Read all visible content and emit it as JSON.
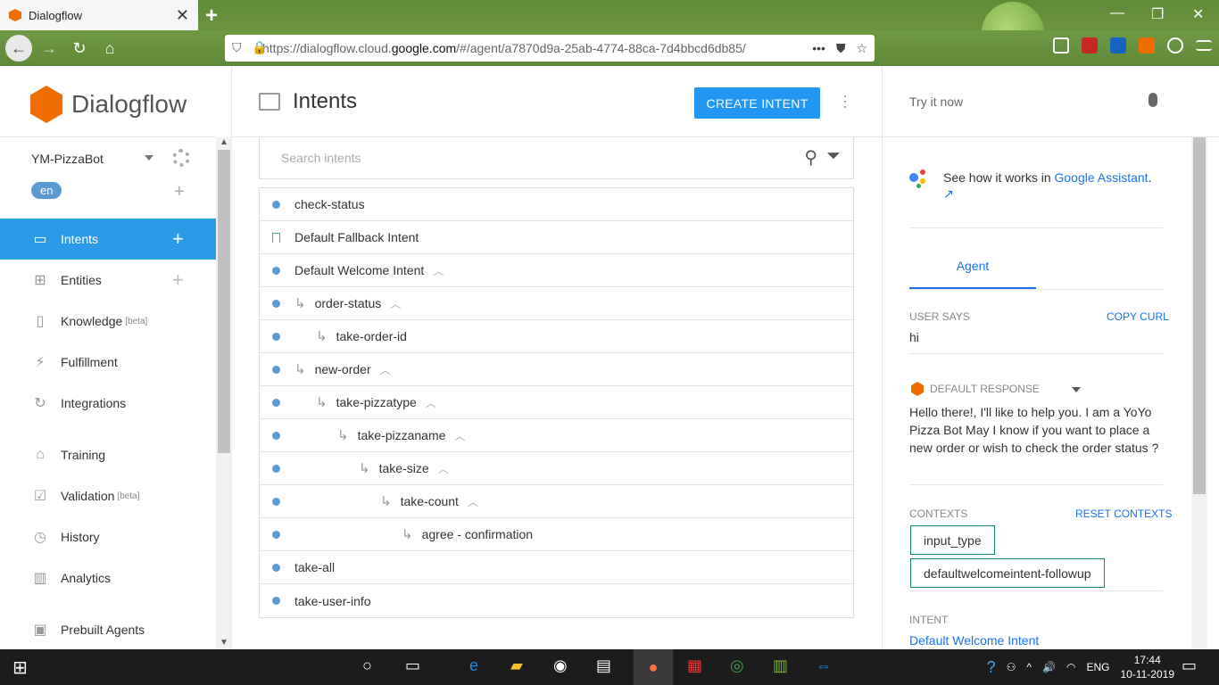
{
  "browser": {
    "tab_title": "Dialogflow",
    "tab_close": "✕",
    "new_tab": "+",
    "url_prefix": "https://dialogflow.cloud.",
    "url_domain": "google.com",
    "url_rest": "/#/agent/a7870d9a-25ab-4774-88ca-7d4bbcd6db85/",
    "url_actions": "•••",
    "window_controls": [
      "—",
      "❐",
      "✕"
    ]
  },
  "sidebar": {
    "brand": "Dialogflow",
    "agent_name": "YM-PizzaBot",
    "language": "en",
    "add_lang": "+",
    "items": [
      {
        "label": "Intents",
        "beta": "",
        "plus": "+",
        "icon": "chat-icon"
      },
      {
        "label": "Entities",
        "beta": "",
        "plus": "+",
        "icon": "sitemap-icon"
      },
      {
        "label": "Knowledge",
        "beta": "[beta]",
        "plus": "",
        "icon": "book-icon"
      },
      {
        "label": "Fulfillment",
        "beta": "",
        "plus": "",
        "icon": "bolt-icon"
      },
      {
        "label": "Integrations",
        "beta": "",
        "plus": "",
        "icon": "sync-icon"
      },
      {
        "label": "Training",
        "beta": "",
        "plus": "",
        "icon": "graduation-icon"
      },
      {
        "label": "Validation",
        "beta": "[beta]",
        "plus": "",
        "icon": "check-icon"
      },
      {
        "label": "History",
        "beta": "",
        "plus": "",
        "icon": "clock-icon"
      },
      {
        "label": "Analytics",
        "beta": "",
        "plus": "",
        "icon": "chart-icon"
      },
      {
        "label": "Prebuilt Agents",
        "beta": "",
        "plus": "",
        "icon": "agents-icon"
      }
    ]
  },
  "main": {
    "title": "Intents",
    "create_button": "CREATE INTENT",
    "search_placeholder": "Search intents",
    "intents": [
      {
        "name": "check-status",
        "depth": 0,
        "child": false,
        "chev": false,
        "marker": "dot"
      },
      {
        "name": "Default Fallback Intent",
        "depth": 0,
        "child": false,
        "chev": false,
        "marker": "bookmark"
      },
      {
        "name": "Default Welcome Intent",
        "depth": 0,
        "child": false,
        "chev": true,
        "marker": "dot"
      },
      {
        "name": "order-status",
        "depth": 0,
        "child": true,
        "chev": true,
        "marker": "dot"
      },
      {
        "name": "take-order-id",
        "depth": 1,
        "child": true,
        "chev": false,
        "marker": "dot"
      },
      {
        "name": "new-order",
        "depth": 0,
        "child": true,
        "chev": true,
        "marker": "dot"
      },
      {
        "name": "take-pizzatype",
        "depth": 1,
        "child": true,
        "chev": true,
        "marker": "dot"
      },
      {
        "name": "take-pizzaname",
        "depth": 2,
        "child": true,
        "chev": true,
        "marker": "dot"
      },
      {
        "name": "take-size",
        "depth": 3,
        "child": true,
        "chev": true,
        "marker": "dot"
      },
      {
        "name": "take-count",
        "depth": 4,
        "child": true,
        "chev": true,
        "marker": "dot"
      },
      {
        "name": "agree - confirmation",
        "depth": 5,
        "child": true,
        "chev": false,
        "marker": "dot"
      },
      {
        "name": "take-all",
        "depth": 0,
        "child": false,
        "chev": false,
        "marker": "dot"
      },
      {
        "name": "take-user-info",
        "depth": 0,
        "child": false,
        "chev": false,
        "marker": "dot"
      }
    ]
  },
  "right": {
    "try_placeholder": "Try it now",
    "see_text": "See how it works in ",
    "see_link": "Google Assistant",
    "see_period": ".",
    "agent_tab": "Agent",
    "user_says_label": "USER SAYS",
    "copy_curl": "COPY CURL",
    "user_says_value": "hi",
    "default_response_label": "DEFAULT RESPONSE",
    "default_response": "Hello there!, I'll like to help you. I am a YoYo Pizza Bot May I know if you want to place a new order or wish to check the order status ?",
    "contexts_label": "CONTEXTS",
    "reset_contexts": "RESET CONTEXTS",
    "contexts": [
      "input_type",
      "defaultwelcomeintent-followup"
    ],
    "intent_label": "INTENT",
    "intent_value": "Default Welcome Intent"
  },
  "taskbar": {
    "lang": "ENG",
    "time": "17:44",
    "date": "10-11-2019"
  },
  "colors": {
    "accent": "#2b9be8",
    "brand": "#ef6c00",
    "context_border": "#0a8a6a"
  }
}
